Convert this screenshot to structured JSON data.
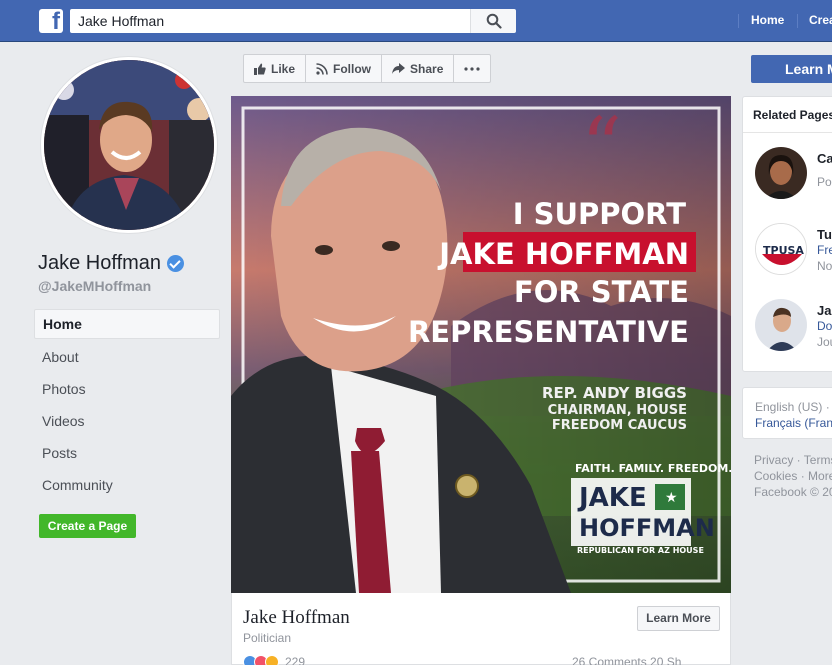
{
  "topbar": {
    "search_value": "Jake Hoffman",
    "nav": [
      "Home",
      "Crea"
    ]
  },
  "profile": {
    "name": "Jake Hoffman",
    "handle": "@JakeMHoffman"
  },
  "sidebar": {
    "items": [
      {
        "label": "Home"
      },
      {
        "label": "About"
      },
      {
        "label": "Photos"
      },
      {
        "label": "Videos"
      },
      {
        "label": "Posts"
      },
      {
        "label": "Community"
      }
    ],
    "create_page": "Create a Page"
  },
  "actions": {
    "like": "Like",
    "follow": "Follow",
    "share": "Share",
    "learn_more_top": "Learn M"
  },
  "cover": {
    "line1": "I SUPPORT",
    "line2": "JAKE HOFFMAN",
    "line3": "FOR STATE",
    "line4": "REPRESENTATIVE",
    "endorser": "REP. ANDY BIGGS",
    "endorser_title1": "CHAIRMAN, HOUSE",
    "endorser_title2": "FREEDOM CAUCUS",
    "slogan": "FAITH. FAMILY. FREEDOM.",
    "logo_line1": "JAKE",
    "logo_line2": "HOFFMAN",
    "logo_sub": "REPUBLICAN FOR AZ HOUSE"
  },
  "page_info": {
    "name": "Jake Hoffman",
    "category": "Politician",
    "learn_more": "Learn More",
    "reactions_count": "229",
    "comments_shares": "26 Comments 20 Sh"
  },
  "related": {
    "heading": "Related Pages",
    "items": [
      {
        "name": "Ca",
        "sub1": "Po",
        "sub2": ""
      },
      {
        "name": "Tu",
        "sub1": "Fre",
        "sub2": "No"
      },
      {
        "name": "Ja",
        "sub1": "Do",
        "sub2": "Jou"
      }
    ]
  },
  "languages": {
    "current": "English (US) ·",
    "other": "Français (Fran"
  },
  "footer": {
    "line1": "Privacy · Terms",
    "line2": "Cookies · More",
    "line3": "Facebook © 20"
  },
  "colors": {
    "brand": "#4267b2",
    "accent_red": "#c8102e",
    "create_green": "#42b72a"
  }
}
